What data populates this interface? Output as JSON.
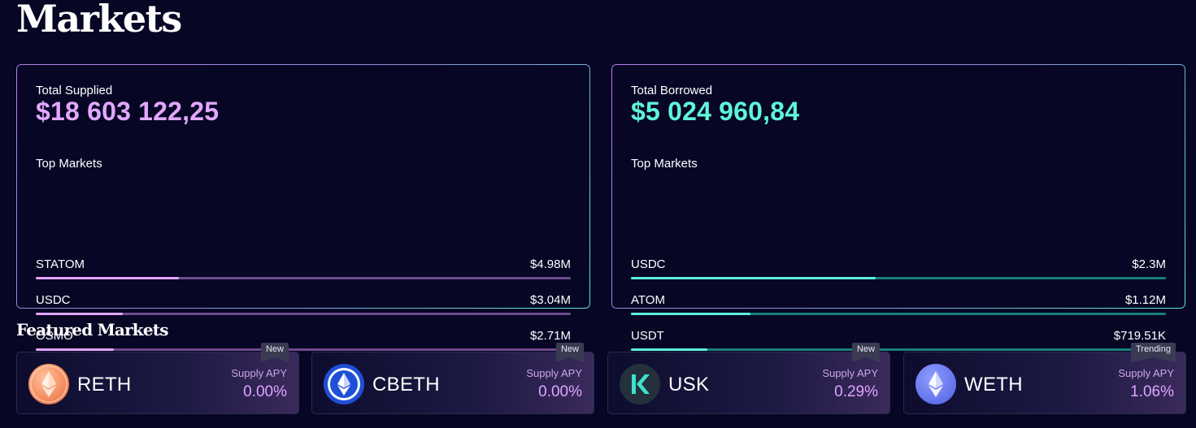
{
  "page": {
    "title": "Markets"
  },
  "supplied": {
    "label": "Total Supplied",
    "total": "$18 603 122,25",
    "top_label": "Top Markets",
    "markets": [
      {
        "name": "STATOM",
        "value": "$4.98M",
        "share": 0.268
      },
      {
        "name": "USDC",
        "value": "$3.04M",
        "share": 0.163
      },
      {
        "name": "OSMO",
        "value": "$2.71M",
        "share": 0.146
      }
    ]
  },
  "borrowed": {
    "label": "Total Borrowed",
    "total": "$5 024 960,84",
    "top_label": "Top Markets",
    "markets": [
      {
        "name": "USDC",
        "value": "$2.3M",
        "share": 0.458
      },
      {
        "name": "ATOM",
        "value": "$1.12M",
        "share": 0.223
      },
      {
        "name": "USDT",
        "value": "$719.51K",
        "share": 0.143
      }
    ]
  },
  "featured": {
    "title": "Featured Markets",
    "cards": [
      {
        "token": "RETH",
        "badge": "New",
        "apy_label": "Supply APY",
        "apy": "0.00%",
        "icon": "reth-icon"
      },
      {
        "token": "CBETH",
        "badge": "New",
        "apy_label": "Supply APY",
        "apy": "0.00%",
        "icon": "cbeth-icon"
      },
      {
        "token": "USK",
        "badge": "New",
        "apy_label": "Supply APY",
        "apy": "0.29%",
        "icon": "usk-icon"
      },
      {
        "token": "WETH",
        "badge": "Trending",
        "apy_label": "Supply APY",
        "apy": "1.06%",
        "icon": "weth-icon"
      }
    ]
  },
  "colors": {
    "background": "#070625",
    "supplied_accent": "#e2a7ff",
    "borrowed_accent": "#5ff5d8"
  }
}
